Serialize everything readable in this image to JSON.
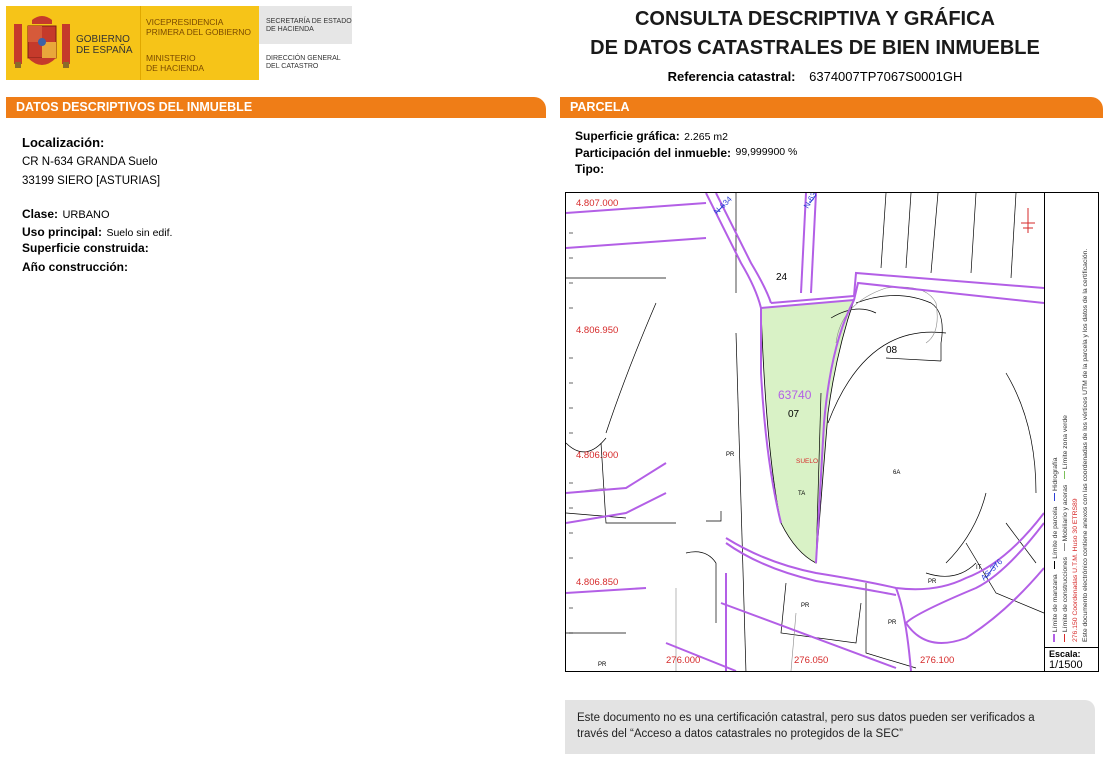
{
  "header": {
    "gobierno": [
      "GOBIERNO",
      "DE ESPAÑA"
    ],
    "vicepresidencia": [
      "VICEPRESIDENCIA",
      "PRIMERA DEL GOBIERNO"
    ],
    "ministerio": [
      "MINISTERIO",
      "DE HACIENDA"
    ],
    "secretaria": [
      "SECRETARÍA DE ESTADO",
      "DE HACIENDA"
    ],
    "direccion": [
      "DIRECCIÓN GENERAL",
      "DEL CATASTRO"
    ],
    "title_line1": "CONSULTA DESCRIPTIVA Y GRÁFICA",
    "title_line2": "DE DATOS CATASTRALES DE BIEN INMUEBLE",
    "ref_label": "Referencia catastral:",
    "ref_value": "6374007TP7067S0001GH"
  },
  "left_section": {
    "header_prefix": "DATOS DESCRIPTIVOS DEL ",
    "header_bold": "INMUEBLE",
    "localizacion_label": "Localización:",
    "localizacion_line1": "CR N-634 GRANDA  Suelo",
    "localizacion_line2": "33199 SIERO [ASTURIAS]",
    "clase_label": "Clase:",
    "clase_value": "URBANO",
    "uso_label": "Uso principal:",
    "uso_value": "Suelo sin edif.",
    "superficie_label": "Superficie construida:",
    "anio_label": "Año construcción:"
  },
  "right_section": {
    "header": "PARCELA",
    "superficie_label": "Superficie gráfica:",
    "superficie_value": "2.265 m2",
    "participacion_label": "Participación del inmueble:",
    "participacion_value": "99,999900 %",
    "tipo_label": "Tipo:"
  },
  "map": {
    "y_labels": [
      "4.807.000",
      "4.806.950",
      "4.806.900",
      "4.806.850"
    ],
    "x_labels": [
      "276.000",
      "276.050",
      "276.100"
    ],
    "parcel_numbers": [
      "24",
      "08",
      "07",
      "6A"
    ],
    "block_id": "63740",
    "suelo_label": "SUELO",
    "road_labels": [
      "PR",
      "PR",
      "PR",
      "PR",
      "PR",
      "TA",
      "IT"
    ],
    "road_refs": [
      "N-634",
      "N-634",
      "AS-376"
    ],
    "legend": {
      "col1": [
        "Límite de manzana",
        "Límite de parcela",
        "Hidrografía"
      ],
      "col2": [
        "Límite de construcciones",
        "Mobiliario y aceras",
        "Límite zona verde"
      ],
      "coords": "276.150 Coordenadas U.T.M. Huso 30 ETRS89",
      "note": "Este documento electrónico contiene anexos con las coordenadas de los vértices UTM de la parcela y los datos de la certificación."
    },
    "scale_label": "Escala:",
    "scale_value": "1/1500"
  },
  "notice": {
    "line1": "Este documento no es una certificación catastral, pero sus datos pueden ser verificados a",
    "line2": "través del “Acceso a datos catastrales no protegidos de la SEC”"
  },
  "colors": {
    "orange": "#ef7d17",
    "yellow": "#f6c418",
    "purple": "#b35fe6",
    "parcel_fill": "#d9f2c6",
    "red": "#d62a2a"
  }
}
